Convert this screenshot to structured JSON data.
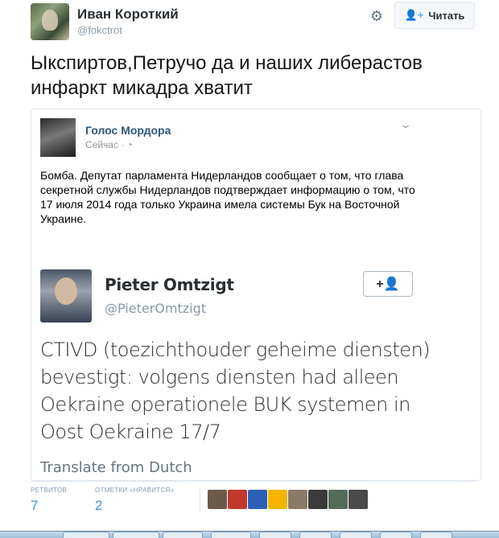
{
  "author": {
    "name": "Иван Короткий",
    "handle": "@fokctrot"
  },
  "header": {
    "follow_label": "Читать",
    "follow_icon": "add-user-icon",
    "settings_icon": "gear-icon"
  },
  "tweet": {
    "text": "Ыкспиртов,Петручо да и наших либерастов инфаркт микадра хватит"
  },
  "card": {
    "name": "Голос Мордора",
    "time": "Сейчас ·",
    "text": "Бомба. Депутат парламента Нидерландов сообщает о том, что глава секретной службы Нидерландов подтверждает информацию о том, что 17 июля 2014 года только Украина имела системы Бук на Восточной Украине."
  },
  "embedded": {
    "name": "Pieter Omtzigt",
    "handle": "@PieterOmtzigt",
    "follow_label": "+👤",
    "text": "CTIVD (toezichthouder geheime diensten) bevestigt: volgens diensten had alleen Oekraine operationele BUK systemen in Oost Oekraine 17/7",
    "translate": "Translate from Dutch"
  },
  "stats": {
    "retweets_label": "РЕТВИТОВ",
    "retweets": "7",
    "likes_label": "ОТМЕТКИ «НРАВИТСЯ»",
    "likes": "2"
  },
  "likers": [
    "#6b5a4a",
    "#c0392b",
    "#2e5fb8",
    "#f4b400",
    "#8a7a6a",
    "#3b3b3b",
    "#556b5a",
    "#4a4a4a"
  ]
}
